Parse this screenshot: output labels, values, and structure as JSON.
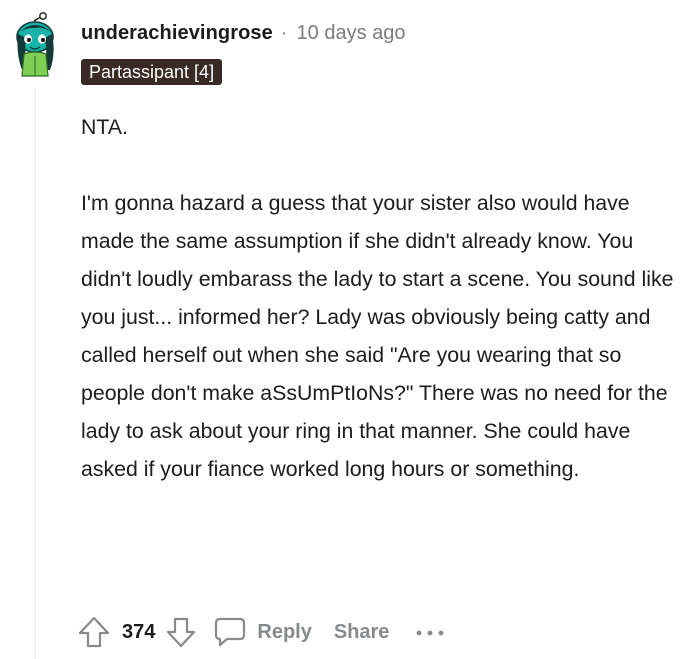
{
  "comment": {
    "username": "underachievingrose",
    "separator": "·",
    "timestamp": "10 days ago",
    "flair": "Partassipant [4]",
    "body": [
      "NTA.",
      "I'm gonna hazard a guess that your sister also would have made the same assumption if she didn't already know. You didn't loudly embarass the lady to start a scene. You sound like you just... informed her? Lady was obviously being catty and called herself out when she said \"Are you wearing that so people don't make aSsUmPtIoNs?\" There was no need for the lady to ask about your ring in that manner. She could have asked if your fiance worked long hours or something."
    ]
  },
  "actions": {
    "vote_count": "374",
    "reply_label": "Reply",
    "share_label": "Share",
    "upvote_icon": "upvote-arrow-icon",
    "downvote_icon": "downvote-arrow-icon",
    "reply_icon": "speech-bubble-icon",
    "more_icon": "ellipsis-icon"
  },
  "colors": {
    "username": "#1c1c1c",
    "meta_text": "#7c7c7c",
    "flair_bg": "#3a2a25",
    "flair_text": "#ffffff",
    "action_text": "#878a8c",
    "avatar_primary": "#17b3a8"
  }
}
